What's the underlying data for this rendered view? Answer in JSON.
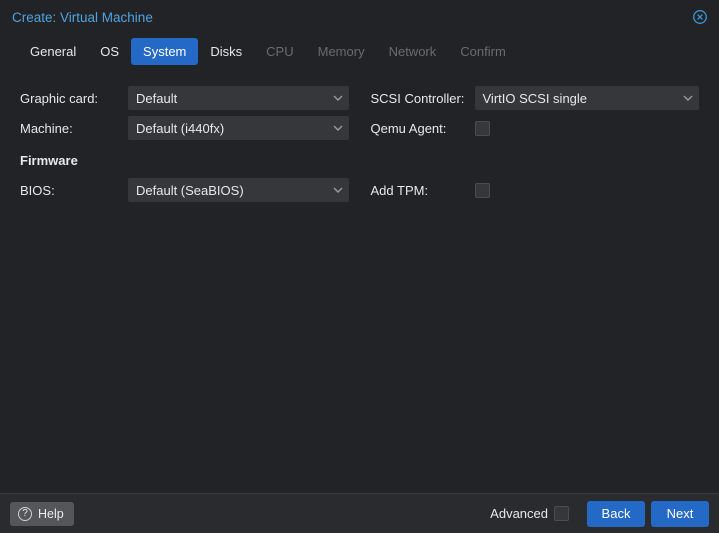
{
  "window": {
    "title": "Create: Virtual Machine"
  },
  "tabs": {
    "general": "General",
    "os": "OS",
    "system": "System",
    "disks": "Disks",
    "cpu": "CPU",
    "memory": "Memory",
    "network": "Network",
    "confirm": "Confirm"
  },
  "labels": {
    "graphic_card": "Graphic card:",
    "machine": "Machine:",
    "firmware": "Firmware",
    "bios": "BIOS:",
    "scsi_controller": "SCSI Controller:",
    "qemu_agent": "Qemu Agent:",
    "add_tpm": "Add TPM:"
  },
  "values": {
    "graphic_card": "Default",
    "machine": "Default (i440fx)",
    "bios": "Default (SeaBIOS)",
    "scsi_controller": "VirtIO SCSI single"
  },
  "footer": {
    "help": "Help",
    "advanced": "Advanced",
    "back": "Back",
    "next": "Next"
  }
}
